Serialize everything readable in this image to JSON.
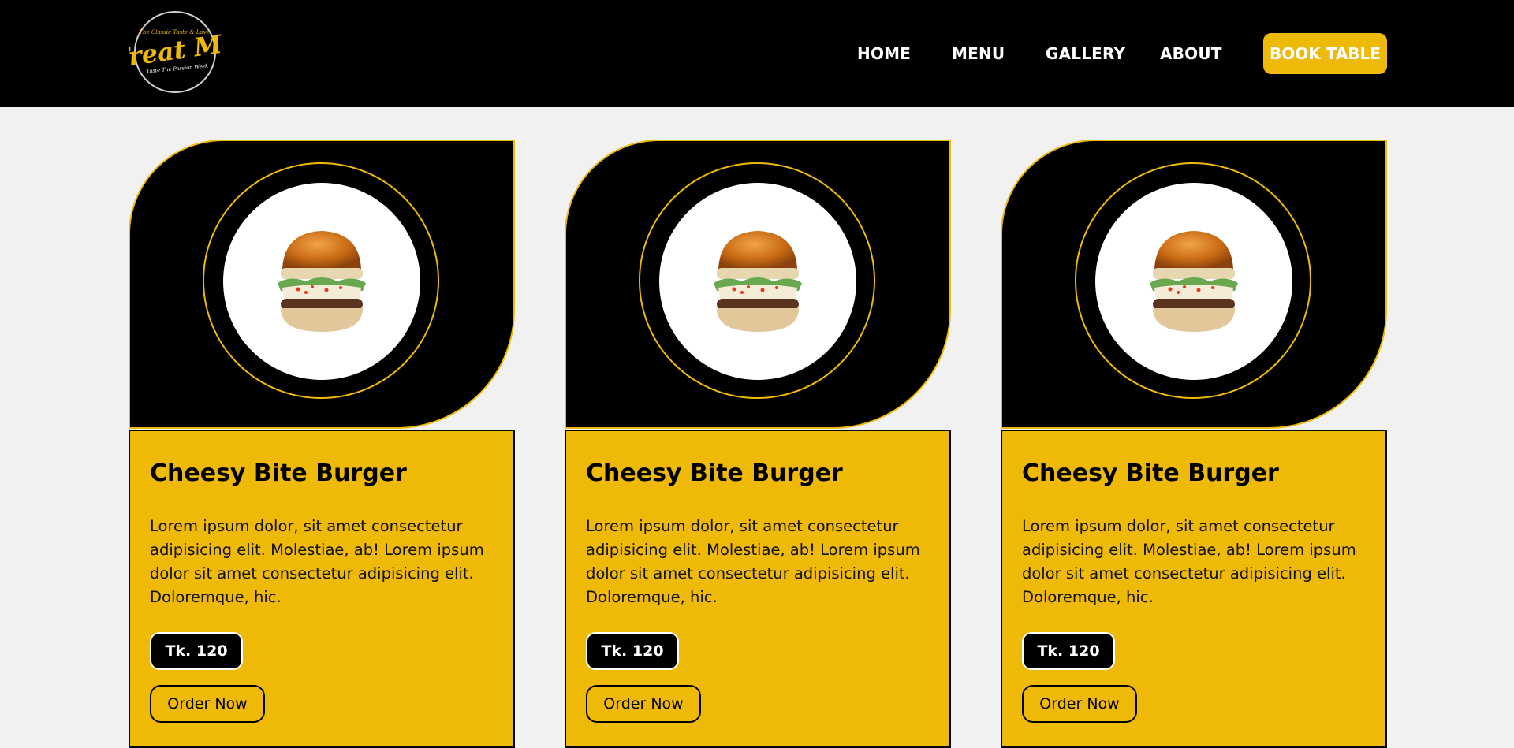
{
  "brand": {
    "logo_text": "Treat Me",
    "logo_tagline": "Taste The Passion Week",
    "logo_arc_text": "The Classic Taste & Love",
    "accent": "#efb907",
    "header_bg": "#000000",
    "page_bg": "#f1f1f1"
  },
  "nav": {
    "items": [
      "HOME",
      "MENU",
      "GALLERY",
      "ABOUT"
    ],
    "cta": "BOOK TABLE"
  },
  "cards": [
    {
      "image": "burger-image",
      "title": "Cheesy Bite Burger",
      "description": "Lorem ipsum dolor, sit amet consectetur adipisicing elit. Molestiae, ab! Lorem ipsum dolor sit amet consectetur adipisicing elit. Doloremque, hic.",
      "price": "Tk. 120",
      "button": "Order Now"
    },
    {
      "image": "burger-image",
      "title": "Cheesy Bite Burger",
      "description": "Lorem ipsum dolor, sit amet consectetur adipisicing elit. Molestiae, ab! Lorem ipsum dolor sit amet consectetur adipisicing elit. Doloremque, hic.",
      "price": "Tk. 120",
      "button": "Order Now"
    },
    {
      "image": "burger-image",
      "title": "Cheesy Bite Burger",
      "description": "Lorem ipsum dolor, sit amet consectetur adipisicing elit. Molestiae, ab! Lorem ipsum dolor sit amet consectetur adipisicing elit. Doloremque, hic.",
      "price": "Tk. 120",
      "button": "Order Now"
    }
  ]
}
